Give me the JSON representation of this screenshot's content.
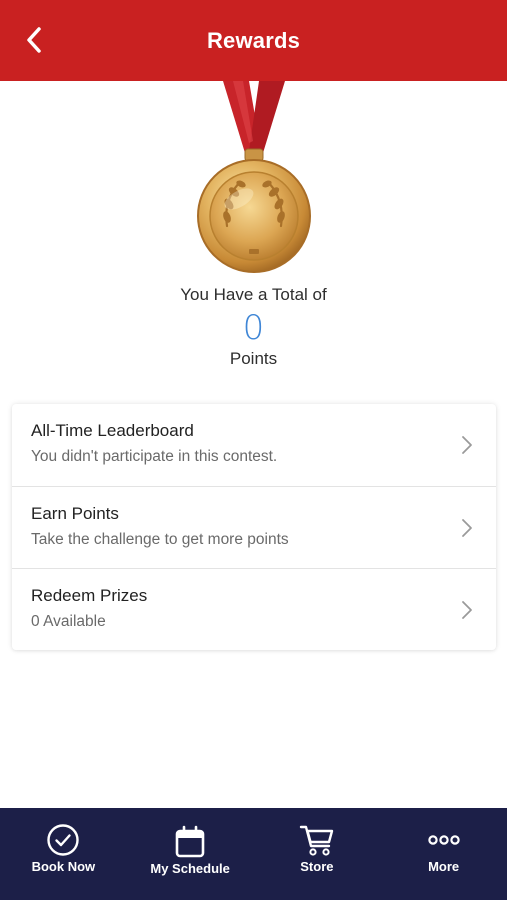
{
  "header": {
    "title": "Rewards"
  },
  "summary": {
    "total_label": "You Have a Total of",
    "points_value": "0",
    "points_label": "Points"
  },
  "menu": {
    "items": [
      {
        "title": "All-Time Leaderboard",
        "subtitle": "You didn't participate in this contest."
      },
      {
        "title": "Earn Points",
        "subtitle": "Take the challenge to get more points"
      },
      {
        "title": "Redeem Prizes",
        "subtitle": "0 Available"
      }
    ]
  },
  "tabbar": {
    "tabs": [
      {
        "label": "Book Now",
        "icon": "check-circle-icon"
      },
      {
        "label": "My Schedule",
        "icon": "calendar-icon"
      },
      {
        "label": "Store",
        "icon": "cart-icon"
      },
      {
        "label": "More",
        "icon": "more-icon"
      }
    ]
  },
  "colors": {
    "header": "#c92121",
    "tabbar": "#1c1f48",
    "points": "#3f86d6",
    "medal_gold": "#d8a24a"
  }
}
